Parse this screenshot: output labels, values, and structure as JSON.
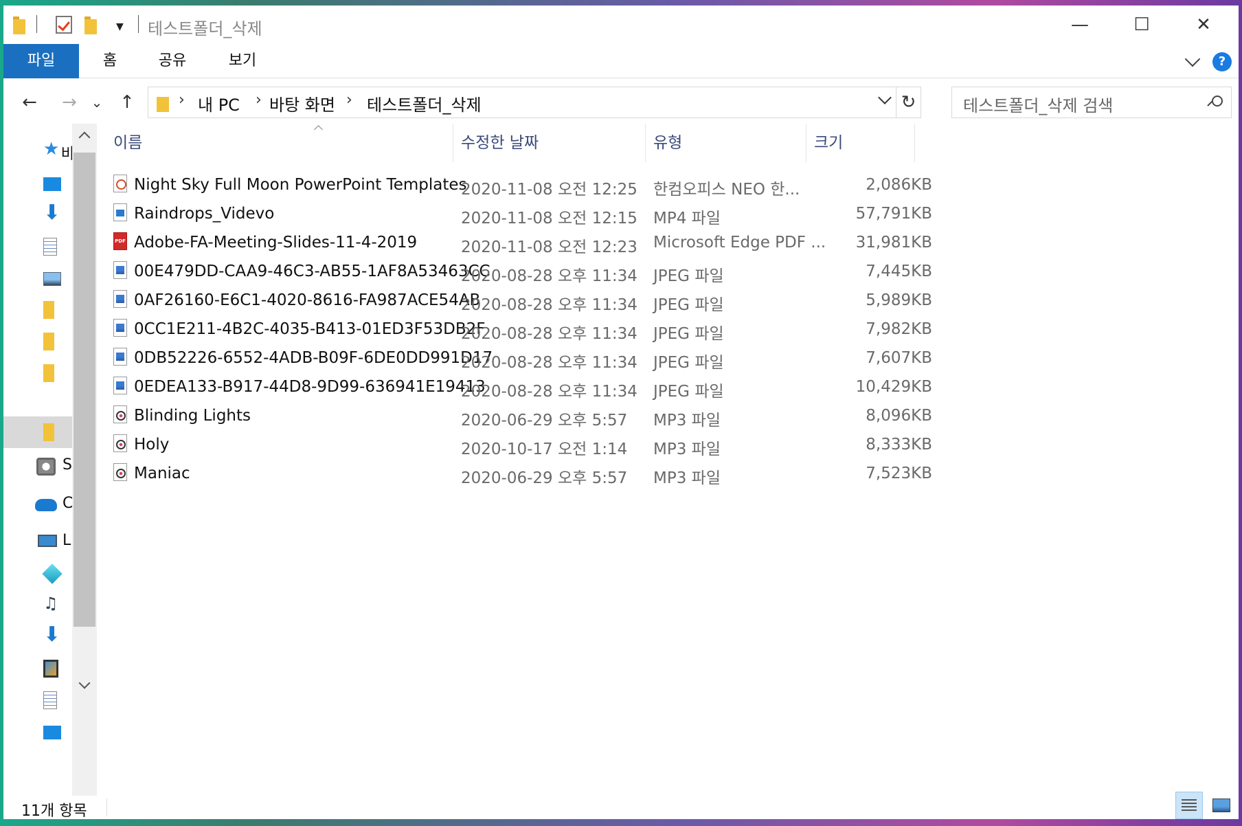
{
  "window": {
    "title": "테스트폴더_삭제",
    "controls": {
      "minimize": "—",
      "maximize": "☐",
      "close": "✕"
    }
  },
  "ribbon": {
    "tabs": [
      "파일",
      "홈",
      "공유",
      "보기"
    ],
    "help_label": "?"
  },
  "nav": {
    "back": "←",
    "forward": "→",
    "recent": "⌄",
    "up": "↑",
    "breadcrumb": [
      "내 PC",
      "바탕 화면",
      "테스트폴더_삭제"
    ],
    "breadcrumb_sep": "›",
    "refresh": "↻",
    "search_placeholder": "테스트폴더_삭제 검색"
  },
  "navpane": {
    "items": [
      {
        "icon": "star-icon",
        "label": "바"
      },
      {
        "icon": "desktop-icon",
        "label": ""
      },
      {
        "icon": "download-icon",
        "label": ""
      },
      {
        "icon": "document-icon",
        "label": ""
      },
      {
        "icon": "picture-icon",
        "label": ""
      },
      {
        "icon": "folder-icon",
        "label": ""
      },
      {
        "icon": "folder-icon",
        "label": ""
      },
      {
        "icon": "folder-icon",
        "label": ""
      },
      {
        "icon": "folder-icon",
        "label": "",
        "selected": true
      },
      {
        "icon": "disk-icon",
        "label": "S"
      },
      {
        "icon": "onedrive-icon",
        "label": "C"
      },
      {
        "icon": "computer-icon",
        "label": "L"
      },
      {
        "icon": "3d-objects-icon",
        "label": ""
      },
      {
        "icon": "music-icon",
        "label": ""
      },
      {
        "icon": "download-icon",
        "label": ""
      },
      {
        "icon": "video-icon",
        "label": ""
      },
      {
        "icon": "document-icon",
        "label": ""
      },
      {
        "icon": "desktop-icon",
        "label": ""
      }
    ]
  },
  "columns": {
    "name": "이름",
    "date": "수정한 날짜",
    "type": "유형",
    "size": "크기"
  },
  "files": [
    {
      "icon": "ppt",
      "name": "Night Sky Full Moon  PowerPoint Templates",
      "date": "2020-11-08 오전 12:25",
      "type": "한컴오피스 NEO 한...",
      "size": "2,086KB"
    },
    {
      "icon": "mp4",
      "name": "Raindrops_Videvo",
      "date": "2020-11-08 오전 12:15",
      "type": "MP4 파일",
      "size": "57,791KB"
    },
    {
      "icon": "pdf",
      "name": "Adobe-FA-Meeting-Slides-11-4-2019",
      "date": "2020-11-08 오전 12:23",
      "type": "Microsoft Edge PDF ...",
      "size": "31,981KB"
    },
    {
      "icon": "jpg",
      "name": "00E479DD-CAA9-46C3-AB55-1AF8A53463CC",
      "date": "2020-08-28 오후 11:34",
      "type": "JPEG 파일",
      "size": "7,445KB"
    },
    {
      "icon": "jpg",
      "name": "0AF26160-E6C1-4020-8616-FA987ACE54AB",
      "date": "2020-08-28 오후 11:34",
      "type": "JPEG 파일",
      "size": "5,989KB"
    },
    {
      "icon": "jpg",
      "name": "0CC1E211-4B2C-4035-B413-01ED3F53DB2F",
      "date": "2020-08-28 오후 11:34",
      "type": "JPEG 파일",
      "size": "7,982KB"
    },
    {
      "icon": "jpg",
      "name": "0DB52226-6552-4ADB-B09F-6DE0DD991D17",
      "date": "2020-08-28 오후 11:34",
      "type": "JPEG 파일",
      "size": "7,607KB"
    },
    {
      "icon": "jpg",
      "name": "0EDEA133-B917-44D8-9D99-636941E19413",
      "date": "2020-08-28 오후 11:34",
      "type": "JPEG 파일",
      "size": "10,429KB"
    },
    {
      "icon": "mp3",
      "name": "Blinding Lights",
      "date": "2020-06-29 오후 5:57",
      "type": "MP3 파일",
      "size": "8,096KB"
    },
    {
      "icon": "mp3",
      "name": "Holy",
      "date": "2020-10-17 오전 1:14",
      "type": "MP3 파일",
      "size": "8,333KB"
    },
    {
      "icon": "mp3",
      "name": "Maniac",
      "date": "2020-06-29 오후 5:57",
      "type": "MP3 파일",
      "size": "7,523KB"
    }
  ],
  "status": {
    "item_count": "11개 항목"
  }
}
